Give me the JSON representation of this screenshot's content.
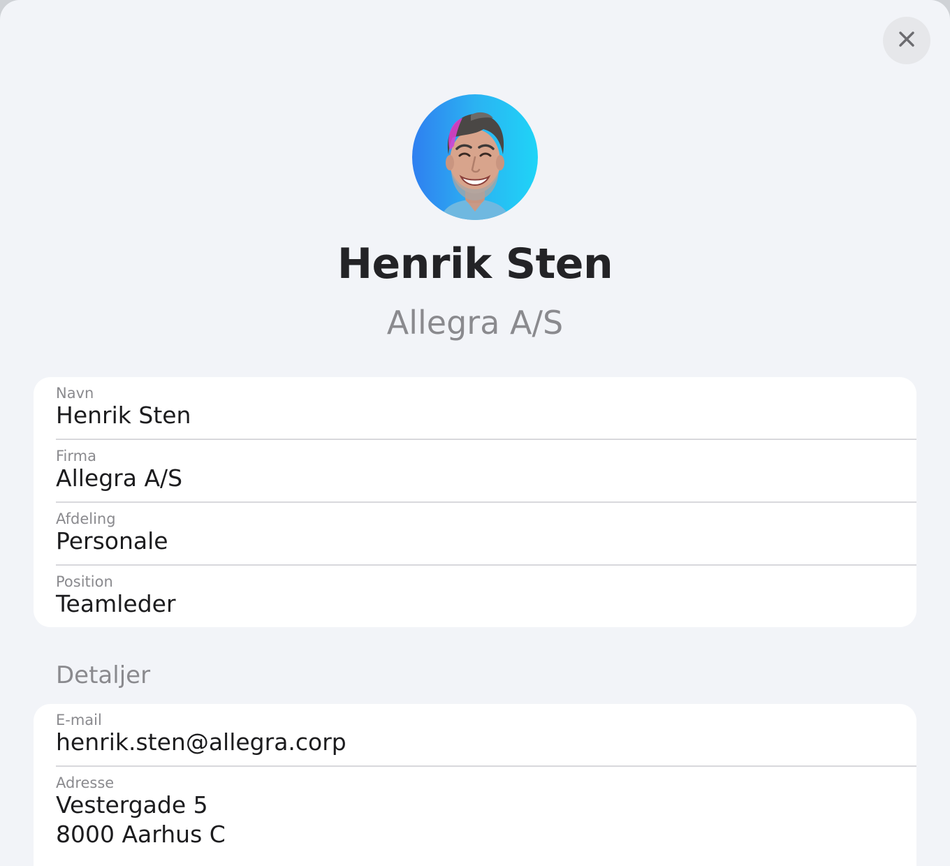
{
  "close_button": {
    "icon": "close-icon"
  },
  "profile": {
    "name": "Henrik Sten",
    "company": "Allegra A/S"
  },
  "fields": [
    {
      "label": "Navn",
      "value": "Henrik Sten"
    },
    {
      "label": "Firma",
      "value": "Allegra A/S"
    },
    {
      "label": "Afdeling",
      "value": "Personale"
    },
    {
      "label": "Position",
      "value": "Teamleder"
    }
  ],
  "details": {
    "heading": "Detaljer",
    "email": {
      "label": "E-mail",
      "value": "henrik.sten@allegra.corp"
    },
    "address": {
      "label": "Adresse",
      "value": "Vestergade 5\n8000 Aarhus C"
    }
  },
  "colors": {
    "background": "#f2f4f8",
    "card": "#ffffff",
    "primary_text": "#1c1c1e",
    "secondary_text": "#8a8a8e",
    "divider": "#d8d8dc",
    "avatar_gradient_start": "#2f7ff0",
    "avatar_gradient_end": "#1fd4f7",
    "avatar_hair_highlight": "#e040d0"
  }
}
